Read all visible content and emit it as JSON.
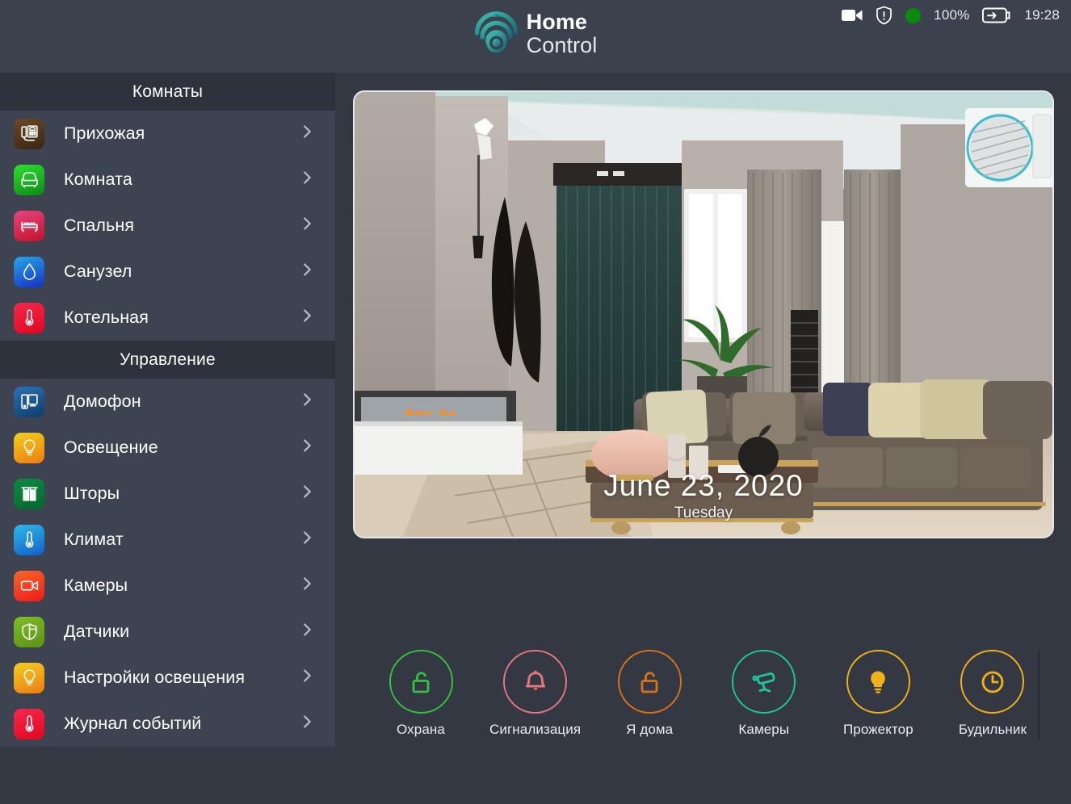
{
  "statusbar": {
    "icons": [
      "video-camera-icon",
      "shield-alert-icon",
      "recording-dot-icon"
    ],
    "battery_percent": "100%",
    "battery_icon": "battery-charging-icon",
    "time": "19:28"
  },
  "logo": {
    "icon": "home-control-logo-icon",
    "line1": "Home",
    "line2": "Control",
    "color_start": "#35b0a4",
    "color_end": "#1c6b78"
  },
  "sidebar": {
    "sections": [
      {
        "title": "Комнаты",
        "items": [
          {
            "label": "Прихожая",
            "icon": "intercom-phone-icon",
            "color_start": "#6b4a25",
            "color_end": "#3a2512",
            "chevron": "chevron-right-icon"
          },
          {
            "label": "Комната",
            "icon": "armchair-icon",
            "color_start": "#2ee02e",
            "color_end": "#0d8a16",
            "chevron": "chevron-right-icon"
          },
          {
            "label": "Спальня",
            "icon": "bed-icon",
            "color_start": "#e8447f",
            "color_end": "#c2132a",
            "chevron": "chevron-right-icon"
          },
          {
            "label": "Санузел",
            "icon": "water-drop-icon",
            "color_start": "#2aa6e8",
            "color_end": "#1432c4",
            "chevron": "chevron-right-icon"
          },
          {
            "label": "Котельная",
            "icon": "thermometer-icon",
            "color_start": "#f4294b",
            "color_end": "#e3061f",
            "chevron": "chevron-right-icon"
          }
        ]
      },
      {
        "title": "Управление",
        "items": [
          {
            "label": "Домофон",
            "icon": "intercom-monitor-icon",
            "color_start": "#2b73b8",
            "color_end": "#0d3c6b",
            "chevron": "chevron-right-icon"
          },
          {
            "label": "Освещение",
            "icon": "lightbulb-icon",
            "color_start": "#f0cf1e",
            "color_end": "#ef7b13",
            "chevron": "chevron-right-icon"
          },
          {
            "label": "Шторы",
            "icon": "curtains-icon",
            "color_start": "#0f8a42",
            "color_end": "#06662f",
            "chevron": "chevron-right-icon"
          },
          {
            "label": "Климат",
            "icon": "thermometer-icon",
            "color_start": "#30b8ea",
            "color_end": "#1160c8",
            "chevron": "chevron-right-icon"
          },
          {
            "label": "Камеры",
            "icon": "video-camera-icon",
            "color_start": "#f4682a",
            "color_end": "#ee1a1a",
            "chevron": "chevron-right-icon"
          },
          {
            "label": "Датчики",
            "icon": "shield-sensor-icon",
            "color_start": "#7fbb28",
            "color_end": "#5a9416",
            "chevron": "chevron-right-icon"
          },
          {
            "label": "Настройки освещения",
            "icon": "lightbulb-icon",
            "color_start": "#f0cf1e",
            "color_end": "#ef7b13",
            "chevron": "chevron-right-icon"
          },
          {
            "label": "Журнал событий",
            "icon": "thermometer-icon",
            "color_start": "#f4294b",
            "color_end": "#e3061f",
            "chevron": "chevron-right-icon"
          }
        ]
      }
    ]
  },
  "main": {
    "photo": {
      "name": "living-room-photo",
      "alt": "Living room interior"
    },
    "date": {
      "full": "June 23, 2020",
      "weekday": "Tuesday"
    },
    "actions": [
      {
        "label": "Охрана",
        "icon": "padlock-open-icon",
        "color": "#33c13f"
      },
      {
        "label": "Сигнализация",
        "icon": "bell-icon",
        "color": "#e8757f"
      },
      {
        "label": "Я дома",
        "icon": "padlock-open-icon",
        "color": "#d9711a"
      },
      {
        "label": "Камеры",
        "icon": "cctv-camera-icon",
        "color": "#1fc49b"
      },
      {
        "label": "Прожектор",
        "icon": "lightbulb-solid-icon",
        "color": "#f0b11a"
      },
      {
        "label": "Будильник",
        "icon": "alarm-clock-icon",
        "color": "#f0b11a"
      }
    ]
  }
}
